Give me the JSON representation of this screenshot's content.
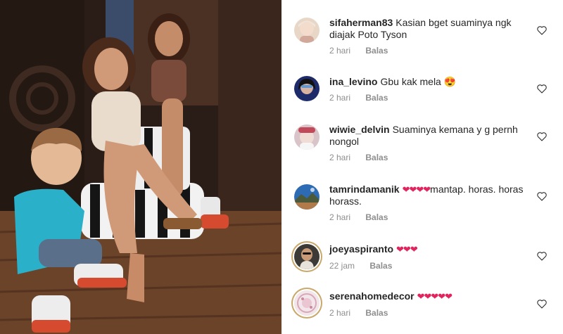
{
  "photo": {
    "alt_icon": "family-photo"
  },
  "comments": [
    {
      "username": "sifaherman83",
      "text": "Kasian bget suaminya ngk diajak Poto Tyson",
      "hearts": "",
      "time": "2 hari",
      "reply_label": "Balas",
      "avatar_color": "#e8d6c6"
    },
    {
      "username": "ina_levino",
      "text": "Gbu kak mela",
      "hearts": "😍",
      "time": "2 hari",
      "reply_label": "Balas",
      "avatar_color": "#1d2b6b"
    },
    {
      "username": "wiwie_delvin",
      "text": "Suaminya kemana y g pernh nongol",
      "hearts": "",
      "time": "2 hari",
      "reply_label": "Balas",
      "avatar_color": "#d9c4c9"
    },
    {
      "username": "tamrindamanik",
      "text": "mantap.  horas. horas horass.",
      "hearts": "❤❤❤❤",
      "time": "2 hari",
      "reply_label": "Balas",
      "avatar_color": "#2e6bb5"
    },
    {
      "username": "joeyaspiranto",
      "text": "",
      "hearts": "❤❤❤",
      "time": "22 jam",
      "reply_label": "Balas",
      "avatar_color": "#3c3a36"
    },
    {
      "username": "serenahomedecor",
      "text": "",
      "hearts": "❤❤❤❤❤",
      "time": "2 hari",
      "reply_label": "Balas",
      "avatar_color": "#f2e6ea"
    }
  ],
  "colors": {
    "heart_red": "#e0245e",
    "meta_gray": "#8e8e8e",
    "text_dark": "#262626"
  }
}
